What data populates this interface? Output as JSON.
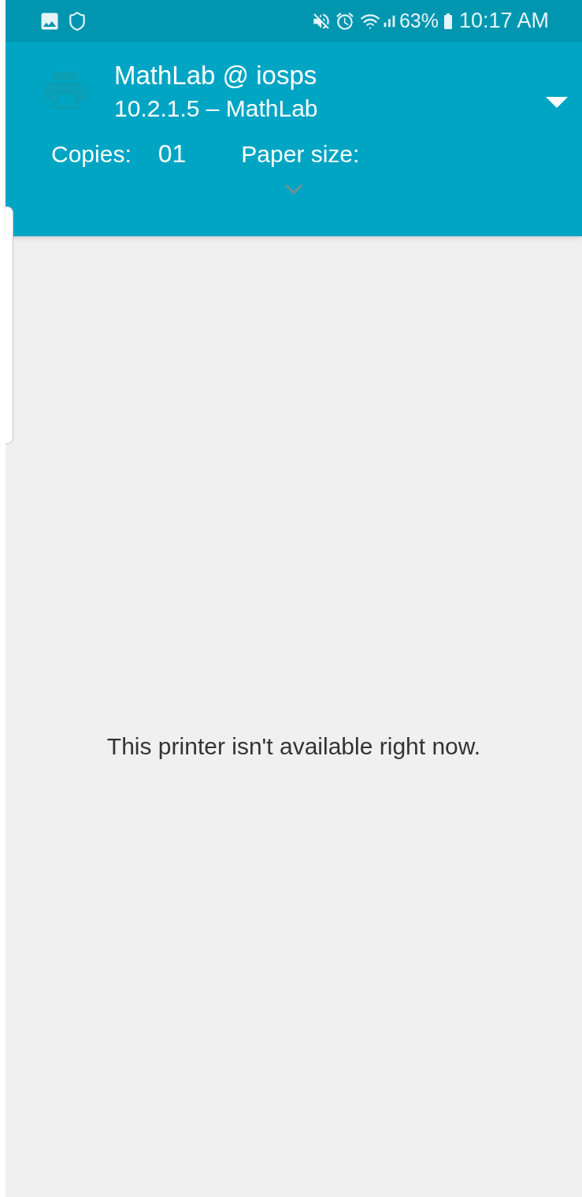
{
  "status_bar": {
    "battery": "63%",
    "time": "10:17 AM"
  },
  "header": {
    "printer_name": "MathLab @ iosps",
    "printer_detail": "10.2.1.5 – MathLab",
    "copies_label": "Copies:",
    "copies_value": "01",
    "paper_size_label": "Paper size:"
  },
  "message": "This printer isn't available right now."
}
